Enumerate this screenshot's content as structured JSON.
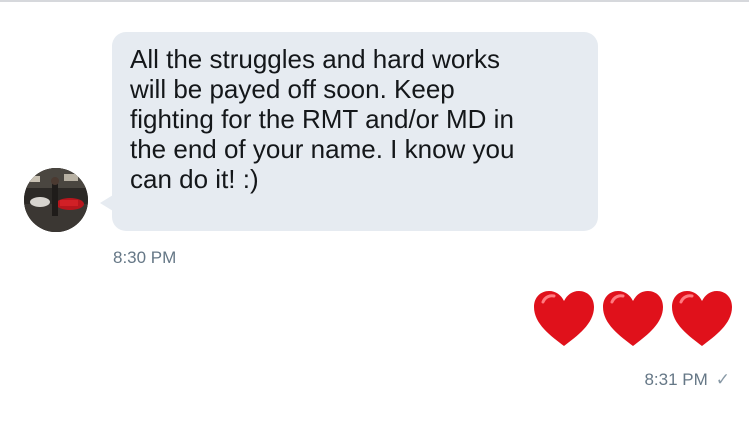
{
  "conversation": {
    "incoming": {
      "lines": [
        "All the struggles and hard works",
        "will be payed off soon. Keep",
        "fighting for the RMT and/or MD in",
        "the end of your name. I know you",
        "can do it! :)"
      ],
      "timestamp": "8:30 PM"
    },
    "outgoing": {
      "emoji": [
        "❤️",
        "❤️",
        "❤️"
      ],
      "timestamp": "8:31 PM",
      "status_icon": "checkmark-icon"
    }
  },
  "colors": {
    "bubble_incoming": "#e6ebf1",
    "text": "#14171a",
    "timestamp": "#657786",
    "heart": "#e0111b"
  }
}
